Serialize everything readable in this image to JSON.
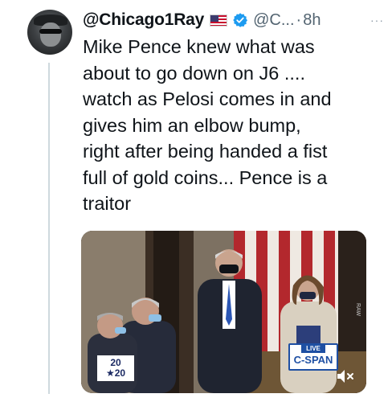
{
  "tweet": {
    "username": "@Chicago1Ray",
    "handle": "@C...",
    "separator": "·",
    "time": "8h",
    "more": "···",
    "text": "Mike Pence knew what was\nabout to go down on J6 ....\nwatch as Pelosi comes in and\ngives him an elbow bump,\nright after being handed a fist\nfull of gold coins... Pence is a\ntraitor"
  },
  "media": {
    "live_label": "LIVE",
    "network_label": "C-SPAN",
    "year_top": "20",
    "year_bottom": "★20"
  },
  "icons": {
    "flag": "us-flag-icon",
    "verified": "verified-badge-icon",
    "mute": "mute-icon"
  },
  "colors": {
    "verified_blue": "#1d9bf0",
    "secondary_text": "#536471",
    "cspan_blue": "#1e4fa3"
  }
}
